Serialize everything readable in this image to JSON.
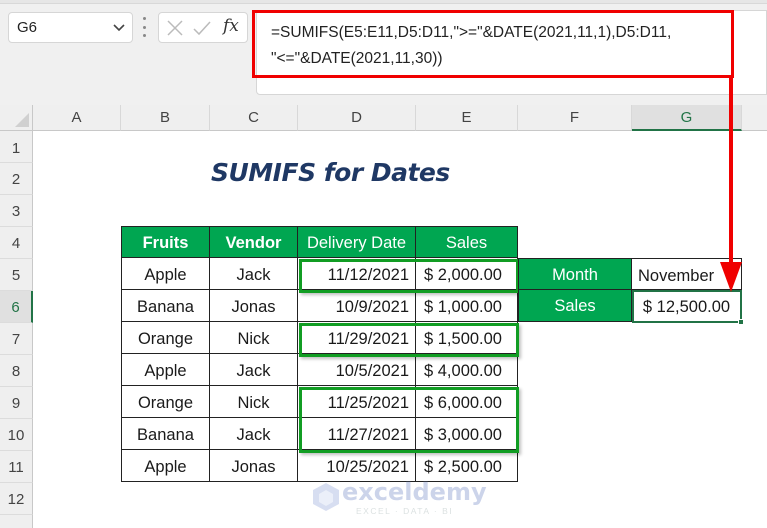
{
  "formula_bar": {
    "name_box": "G6",
    "fx_label": "fx",
    "formula": "=SUMIFS(E5:E11,D5:D11,\">=\"&DATE(2021,11,1),D5:D11,\n\"<=\"&DATE(2021,11,30))"
  },
  "columns": [
    "A",
    "B",
    "C",
    "D",
    "E",
    "F",
    "G"
  ],
  "selected_column": "G",
  "rows": [
    "1",
    "2",
    "3",
    "4",
    "5",
    "6",
    "7",
    "8",
    "9",
    "10",
    "11",
    "12"
  ],
  "selected_row": "6",
  "title": "SUMIFS for Dates",
  "table": {
    "headers": [
      "Fruits",
      "Vendor",
      "Delivery Date",
      "Sales"
    ],
    "rows": [
      [
        "Apple",
        "Jack",
        "11/12/2021",
        "$ 2,000.00"
      ],
      [
        "Banana",
        "Jonas",
        "10/9/2021",
        "$ 1,000.00"
      ],
      [
        "Orange",
        "Nick",
        "11/29/2021",
        "$ 1,500.00"
      ],
      [
        "Apple",
        "Jack",
        "10/5/2021",
        "$ 4,000.00"
      ],
      [
        "Orange",
        "Nick",
        "11/25/2021",
        "$ 6,000.00"
      ],
      [
        "Banana",
        "Jack",
        "11/27/2021",
        "$ 3,000.00"
      ],
      [
        "Apple",
        "Jonas",
        "10/25/2021",
        "$ 2,500.00"
      ]
    ],
    "highlighted_rows": [
      1,
      3,
      5,
      6
    ]
  },
  "summary": {
    "month_label": "Month",
    "month_value": "November",
    "sales_label": "Sales",
    "sales_value": "$ 12,500.00"
  },
  "watermark": {
    "name": "exceldemy",
    "tagline": "EXCEL · DATA · BI"
  },
  "colors": {
    "header_green": "#00a651",
    "highlight_green": "#119d23",
    "annotation_red": "#f00000",
    "title_blue": "#1f3864",
    "excel_green": "#217346"
  }
}
